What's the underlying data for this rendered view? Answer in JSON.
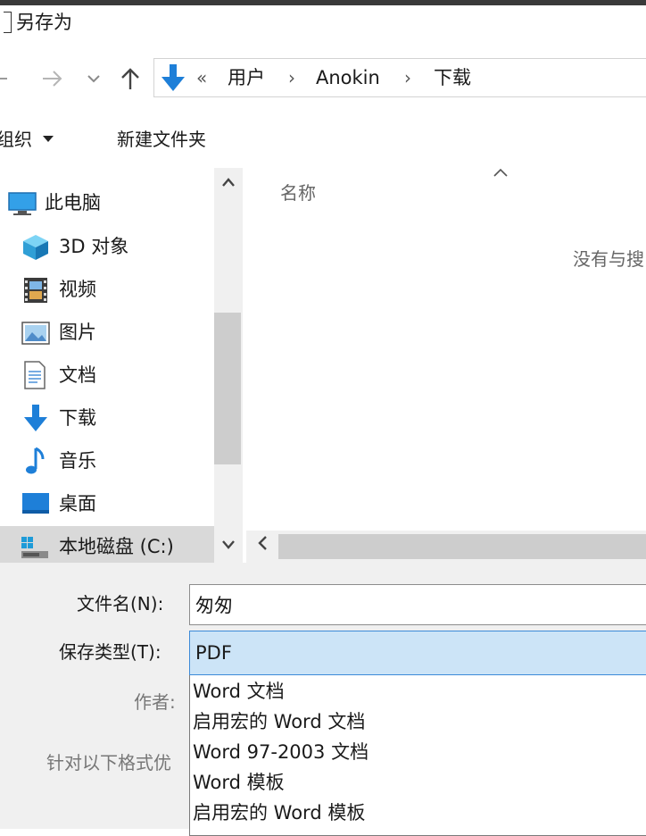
{
  "window": {
    "title": "另存为"
  },
  "address": {
    "overflow": "«",
    "segments": [
      "用户",
      "Anokin",
      "下载"
    ],
    "separator": "›"
  },
  "toolbar": {
    "organize_label": "组织",
    "new_folder_label": "新建文件夹"
  },
  "nav_pane": {
    "items": [
      {
        "label": "此电脑",
        "icon": "computer-icon"
      },
      {
        "label": "3D 对象",
        "icon": "cube-3d-icon"
      },
      {
        "label": "视频",
        "icon": "video-film-icon"
      },
      {
        "label": "图片",
        "icon": "picture-icon"
      },
      {
        "label": "文档",
        "icon": "document-icon"
      },
      {
        "label": "下载",
        "icon": "download-arrow-icon"
      },
      {
        "label": "音乐",
        "icon": "music-note-icon"
      },
      {
        "label": "桌面",
        "icon": "desktop-icon"
      },
      {
        "label": "本地磁盘 (C:)",
        "icon": "local-disk-icon",
        "selected": true
      }
    ]
  },
  "file_list": {
    "column_name": "名称",
    "empty_message": "没有与搜"
  },
  "form": {
    "filename_label": "文件名(N):",
    "filename_value": "匆匆",
    "savetype_label": "保存类型(T):",
    "savetype_value": "PDF",
    "author_label": "作者:",
    "hint_label": "针对以下格式优"
  },
  "savetype_options": [
    "Word 文档",
    "启用宏的 Word 文档",
    "Word 97-2003 文档",
    "Word 模板",
    "启用宏的 Word 模板"
  ],
  "colors": {
    "accent_blue": "#1e7fd8",
    "selection_bg": "#cce4f7",
    "selection_border": "#3c8ad8",
    "panel_bg": "#f0f0f0"
  }
}
